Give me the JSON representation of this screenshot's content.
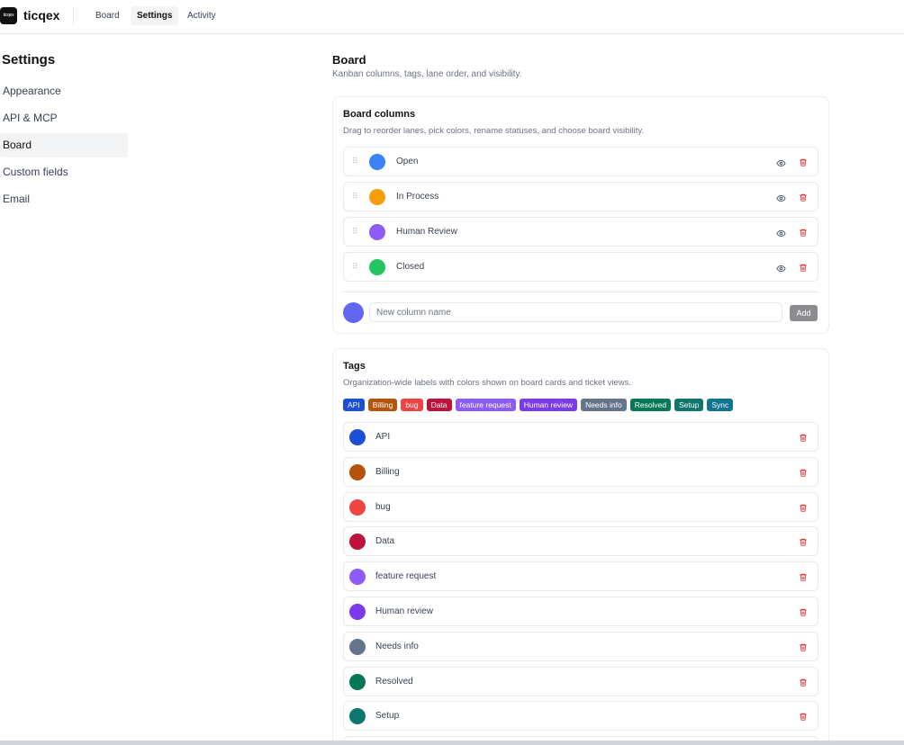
{
  "app": {
    "logo_text": "ticqex",
    "brand": "ticqex"
  },
  "topnav": [
    {
      "label": "Board",
      "active": false
    },
    {
      "label": "Settings",
      "active": true
    },
    {
      "label": "Activity",
      "active": false
    }
  ],
  "sidebar": {
    "title": "Settings",
    "items": [
      {
        "label": "Appearance",
        "active": false
      },
      {
        "label": "API & MCP",
        "active": false
      },
      {
        "label": "Board",
        "active": true
      },
      {
        "label": "Custom fields",
        "active": false
      },
      {
        "label": "Email",
        "active": false
      }
    ]
  },
  "page": {
    "title": "Board",
    "subtitle": "Kanban columns, tags, lane order, and visibility."
  },
  "columns_card": {
    "title": "Board columns",
    "subtitle": "Drag to reorder lanes, pick colors, rename statuses, and choose board visibility.",
    "columns": [
      {
        "name": "Open",
        "color": "#3b82f6"
      },
      {
        "name": "In Process",
        "color": "#f59e0b"
      },
      {
        "name": "Human Review",
        "color": "#8b5cf6"
      },
      {
        "name": "Closed",
        "color": "#22c55e"
      }
    ],
    "new_column": {
      "placeholder": "New column name",
      "value": "",
      "color": "#6366f1",
      "add_label": "Add"
    }
  },
  "tags_card": {
    "title": "Tags",
    "subtitle": "Organization-wide labels with colors shown on board cards and ticket views.",
    "tags": [
      {
        "name": "API",
        "color": "#1d4ed8"
      },
      {
        "name": "Billing",
        "color": "#b45309"
      },
      {
        "name": "bug",
        "color": "#ef4444"
      },
      {
        "name": "Data",
        "color": "#be123c"
      },
      {
        "name": "feature request",
        "color": "#8b5cf6"
      },
      {
        "name": "Human review",
        "color": "#7c3aed"
      },
      {
        "name": "Needs info",
        "color": "#64748b"
      },
      {
        "name": "Resolved",
        "color": "#047857"
      },
      {
        "name": "Setup",
        "color": "#0f766e"
      },
      {
        "name": "Sync",
        "color": "#0e7490"
      }
    ]
  },
  "icons": {
    "drag": "drag-handle-icon",
    "visibility": "eye-icon",
    "delete": "trash-icon"
  }
}
